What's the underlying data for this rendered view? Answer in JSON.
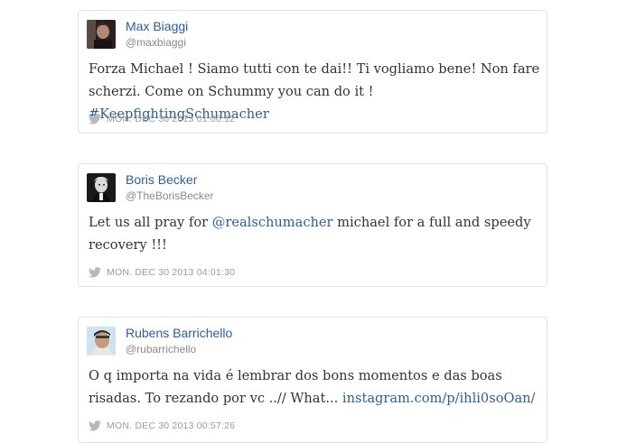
{
  "tweets": [
    {
      "name": "Max Biaggi",
      "handle": "@maxbiaggi",
      "text_before": "Forza Michael ! Siamo tutti con te dai!! Ti vogliamo bene! Non fare scherzi. Come on Schummy you can do it ! ",
      "link": "#KeepfightingSchumacher",
      "text_after": "",
      "timestamp": "MON. DEC 30 2013 01:00:12",
      "avatar": "avatar-max-biaggi"
    },
    {
      "name": "Boris Becker",
      "handle": "@TheBorisBecker",
      "text_before": "Let us all pray for ",
      "link": "@realschumacher",
      "text_after": " michael for a full and speedy recovery !!!",
      "timestamp": "MON. DEC 30 2013 04:01:30",
      "avatar": "avatar-boris-becker"
    },
    {
      "name": "Rubens Barrichello",
      "handle": "@rubarrichello",
      "text_before": "O q importa na vida é lembrar dos bons momentos e das boas risadas. To rezando por vc ..// What... ",
      "link": "instagram.com/p/ihli0soOan/",
      "text_after": "",
      "timestamp": "MON. DEC 30 2013 00:57:26",
      "avatar": "avatar-rubens-barrichello"
    }
  ],
  "colors": {
    "link": "#2b5e9c",
    "handle": "#8a8a8a",
    "timestamp": "#9a9a9a",
    "border": "#e1e1e1"
  },
  "icons": [
    "twitter-bird-icon"
  ]
}
